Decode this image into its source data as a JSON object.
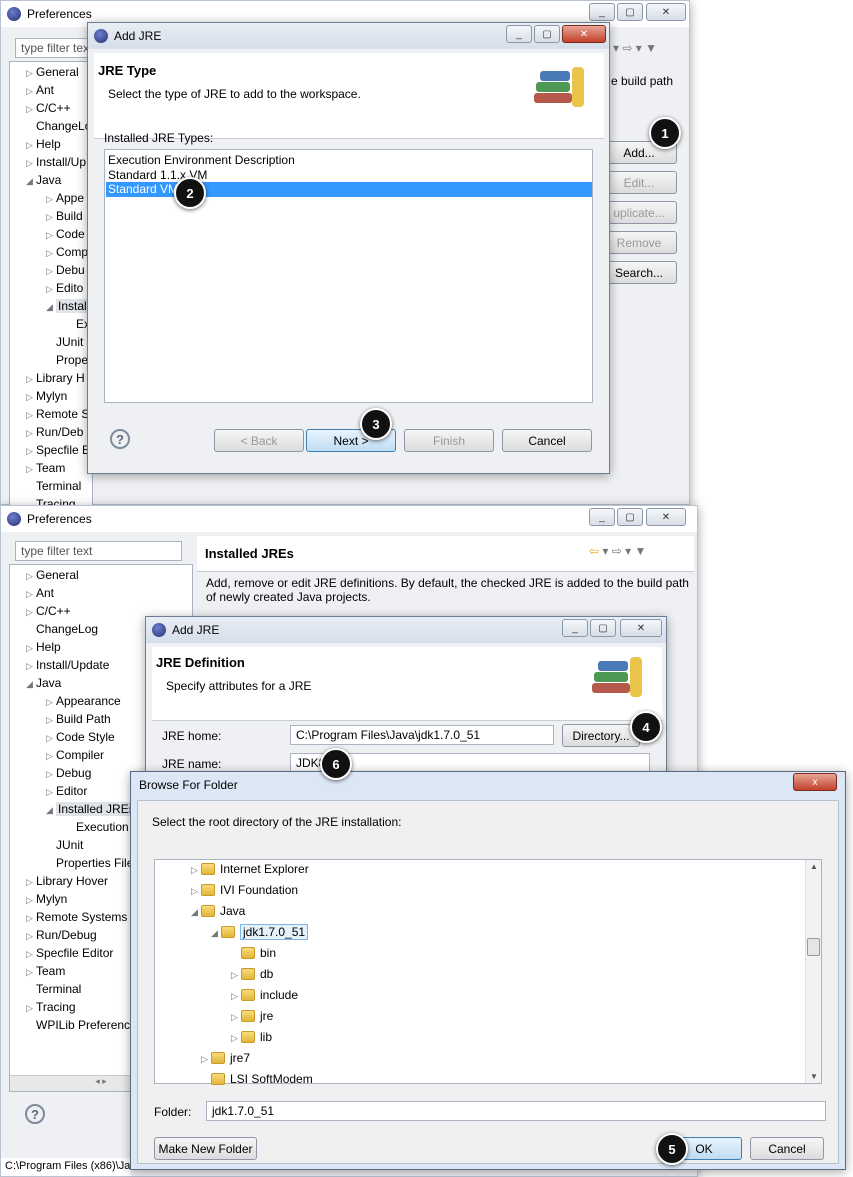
{
  "prefs_top": {
    "title": "Preferences",
    "filter_placeholder": "type filter text",
    "tree": [
      "General",
      "Ant",
      "C/C++",
      "ChangeLog",
      "Help",
      "Install/Up",
      "Java",
      "Appe",
      "Build",
      "Code",
      "Comp",
      "Debu",
      "Edito",
      "Installed",
      "Exe",
      "JUnit",
      "Prope",
      "Library H",
      "Mylyn",
      "Remote S",
      "Run/Deb",
      "Specfile E",
      "Team",
      "Terminal",
      "Tracing"
    ],
    "right_fragments": {
      "build_path": "e build path",
      "add": "Add...",
      "edit": "Edit...",
      "duplicate": "uplicate...",
      "remove": "Remove",
      "search": "Search..."
    }
  },
  "dialog1": {
    "title": "Add JRE",
    "header_title": "JRE Type",
    "header_desc": "Select the type of JRE to add to the workspace.",
    "list_label": "Installed JRE Types:",
    "list_items": [
      "Execution Environment Description",
      "Standard 1.1.x VM",
      "Standard VM"
    ],
    "buttons": {
      "back": "< Back",
      "next": "Next >",
      "finish": "Finish",
      "cancel": "Cancel"
    }
  },
  "prefs_bottom": {
    "title": "Preferences",
    "filter_placeholder": "type filter text",
    "page_title": "Installed JREs",
    "page_desc_1": "Add, remove or edit JRE definitions. By default, the checked JRE is added to the build path",
    "page_desc_2": "of newly created Java projects.",
    "tree": [
      "General",
      "Ant",
      "C/C++",
      "ChangeLog",
      "Help",
      "Install/Update",
      "Java",
      "Appearance",
      "Build Path",
      "Code Style",
      "Compiler",
      "Debug",
      "Editor",
      "Installed JREs",
      "Execution",
      "JUnit",
      "Properties File",
      "Library Hover",
      "Mylyn",
      "Remote Systems",
      "Run/Debug",
      "Specfile Editor",
      "Team",
      "Terminal",
      "Tracing",
      "WPILib Preferenc"
    ],
    "status_path": "C:\\Program Files (x86)\\Ja"
  },
  "dialog2": {
    "title": "Add JRE",
    "header_title": "JRE Definition",
    "header_desc": "Specify attributes for a JRE",
    "jre_home_label": "JRE home:",
    "jre_home_value": "C:\\Program Files\\Java\\jdk1.7.0_51",
    "directory_button": "Directory...",
    "jre_name_label": "JRE name:",
    "jre_name_value": "JDK8"
  },
  "browse": {
    "title": "Browse For Folder",
    "close": "x",
    "instruction": "Select the root directory of the JRE installation:",
    "tree": [
      "Internet Explorer",
      "IVI Foundation",
      "Java",
      "jdk1.7.0_51",
      "bin",
      "db",
      "include",
      "jre",
      "lib",
      "jre7",
      "LSI SoftModem"
    ],
    "folder_label": "Folder:",
    "folder_value": "jdk1.7.0_51",
    "make_new_folder": "Make New Folder",
    "ok": "OK",
    "cancel": "Cancel"
  },
  "badges": [
    "1",
    "2",
    "3",
    "4",
    "5",
    "6"
  ]
}
